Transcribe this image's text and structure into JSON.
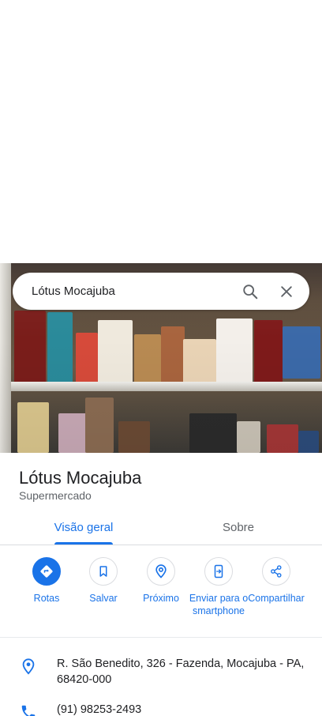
{
  "search": {
    "query": "Lótus Mocajuba"
  },
  "place": {
    "name": "Lótus Mocajuba",
    "category": "Supermercado"
  },
  "tabs": [
    {
      "label": "Visão geral",
      "active": true
    },
    {
      "label": "Sobre",
      "active": false
    }
  ],
  "actions": [
    {
      "label": "Rotas",
      "icon": "directions-icon"
    },
    {
      "label": "Salvar",
      "icon": "bookmark-icon"
    },
    {
      "label": "Próximo",
      "icon": "nearby-icon"
    },
    {
      "label": "Enviar para o smartphone",
      "icon": "send-to-phone-icon"
    },
    {
      "label": "Compartilhar",
      "icon": "share-icon"
    }
  ],
  "info": {
    "address": "R. São Benedito, 326 - Fazenda, Mocajuba - PA, 68420-000",
    "phone": "(91) 98253-2493"
  },
  "colors": {
    "accent": "#1a73e8",
    "text": "#202124",
    "muted": "#5f6368"
  }
}
